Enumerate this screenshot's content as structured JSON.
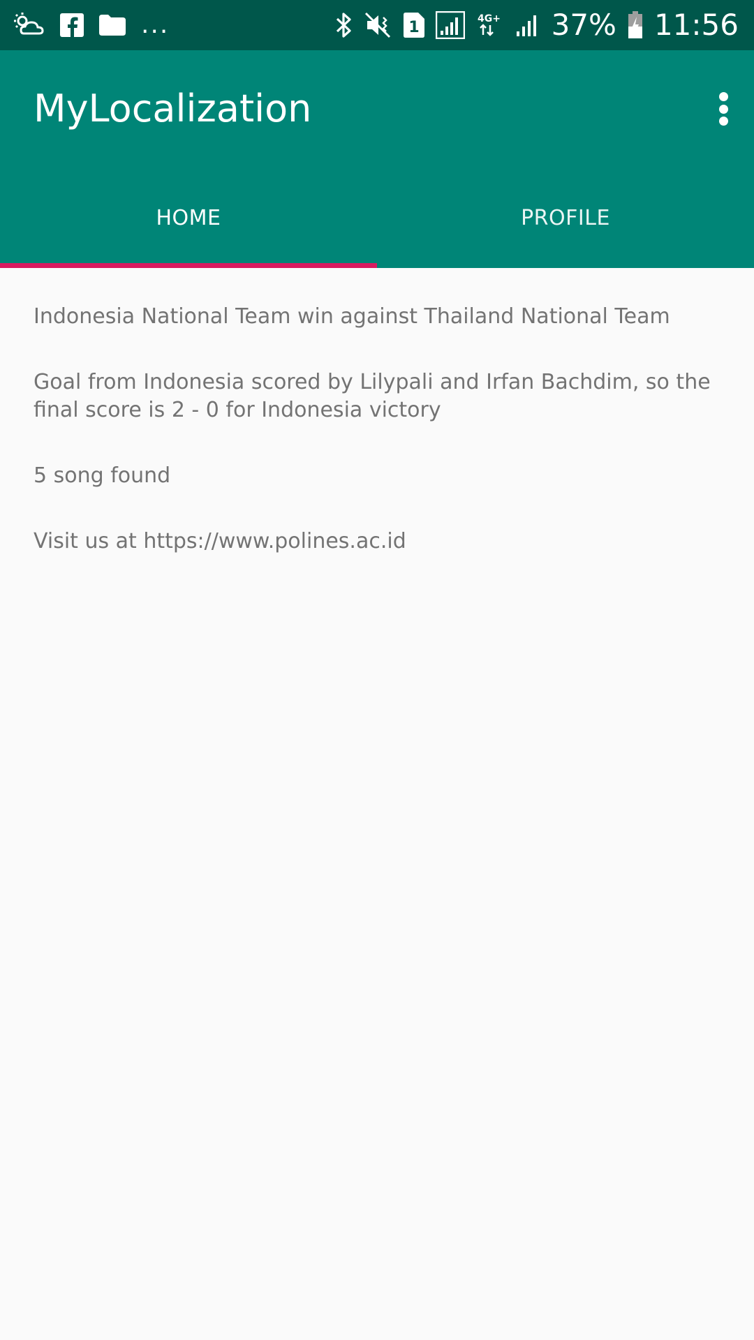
{
  "status_bar": {
    "icons_left": [
      "weather-cloud-icon",
      "facebook-icon",
      "folder-icon"
    ],
    "more_indicator": "...",
    "icons_right": [
      "bluetooth-icon",
      "vibrate-muted-icon",
      "sim-1-icon",
      "signal-icon",
      "network-4g-icon",
      "signal-icon"
    ],
    "network_label": "4G+",
    "battery_percent": "37%",
    "time": "11:56"
  },
  "app_bar": {
    "title": "MyLocalization",
    "background_color": "#008577",
    "status_bar_color": "#00574b",
    "accent_color": "#d81b60"
  },
  "tabs": [
    {
      "label": "HOME",
      "selected": true
    },
    {
      "label": "PROFILE",
      "selected": false
    }
  ],
  "content": {
    "headline": "Indonesia National Team win against Thailand National Team",
    "description": "Goal from Indonesia scored by Lilypali and Irfan Bachdim, so the final score is 2 - 0 for Indonesia victory",
    "songs_found": "5 song found",
    "visit": "Visit us at https://www.polines.ac.id"
  }
}
